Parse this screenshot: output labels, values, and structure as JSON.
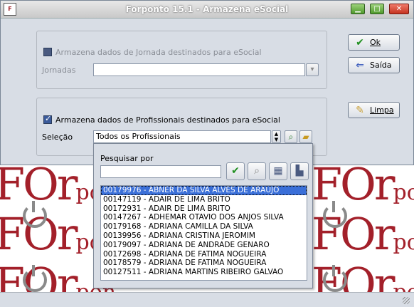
{
  "window": {
    "title": "Forponto 15.1 - Armazena eSocial",
    "app_icon": "forponto-logo",
    "controls": [
      "minimize",
      "maximize",
      "close"
    ]
  },
  "jornada": {
    "checkbox_label": "Armazena dados de Jornada destinados para eSocial",
    "checked": false,
    "enabled": false,
    "field_label": "Jornadas",
    "field_value": ""
  },
  "profissionais": {
    "checkbox_label": "Armazena dados de Profissionais destinados para eSocial",
    "checked": true,
    "field_label": "Seleção",
    "field_value": "Todos os Profissionais"
  },
  "buttons": {
    "ok": "Ok",
    "saida": "Saída",
    "limpa": "Limpa"
  },
  "popup": {
    "search_label": "Pesquisar por",
    "search_value": "",
    "items": [
      "00179976 - ABNER DA SILVA ALVES DE ARAUJO",
      "00147119 - ADAIR DE LIMA BRITO",
      "00172931 - ADAIR DE LIMA BRITO",
      "00147267 - ADHEMAR OTAVIO DOS ANJOS SILVA",
      "00179168 - ADRIANA CAMILLA DA SILVA",
      "00139956 - ADRIANA CRISTINA JEROMIM",
      "00179097 - ADRIANA DE ANDRADE GENARO",
      "00172698 - ADRIANA DE FATIMA NOGUEIRA",
      "00178579 - ADRIANA DE FATIMA NOGUEIRA",
      "00127511 - ADRIANA MARTINS RIBEIRO GALVAO"
    ],
    "selected_index": 0
  },
  "wallpaper": {
    "brand_big": "FOr",
    "brand_small": "pon"
  },
  "colors": {
    "window_bg": "#d8dde5",
    "selection": "#3a6fd8",
    "brand": "#a3202a"
  }
}
